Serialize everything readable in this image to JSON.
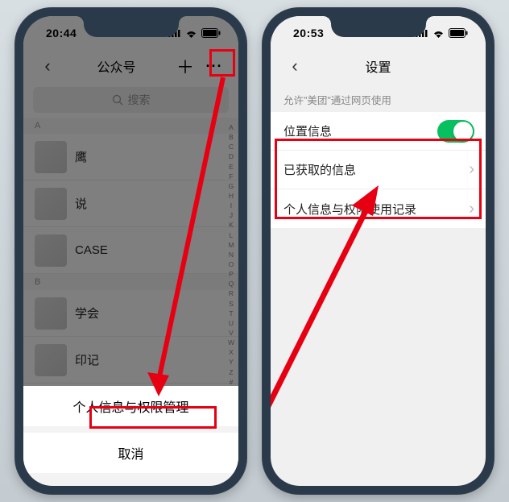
{
  "phone1": {
    "time": "20:44",
    "nav_title": "公众号",
    "search_placeholder": "搜索",
    "sections": [
      {
        "header": "A",
        "rows": [
          {
            "label": "鹰"
          },
          {
            "label": "说"
          },
          {
            "label": "CASE"
          }
        ]
      },
      {
        "header": "B",
        "rows": [
          {
            "label": "学会"
          },
          {
            "label": "印记"
          }
        ]
      }
    ],
    "index_letters": [
      "A",
      "B",
      "C",
      "D",
      "E",
      "F",
      "G",
      "H",
      "I",
      "J",
      "K",
      "L",
      "M",
      "N",
      "O",
      "P",
      "Q",
      "R",
      "S",
      "T",
      "U",
      "V",
      "W",
      "X",
      "Y",
      "Z",
      "#"
    ],
    "sheet_action": "个人信息与权限管理",
    "sheet_cancel": "取消"
  },
  "phone2": {
    "time": "20:53",
    "nav_title": "设置",
    "section_header": "允许\"美团\"通过网页使用",
    "rows": [
      {
        "label": "位置信息",
        "kind": "switch"
      },
      {
        "label": "已获取的信息",
        "kind": "link"
      },
      {
        "label": "个人信息与权限使用记录",
        "kind": "link"
      }
    ]
  }
}
